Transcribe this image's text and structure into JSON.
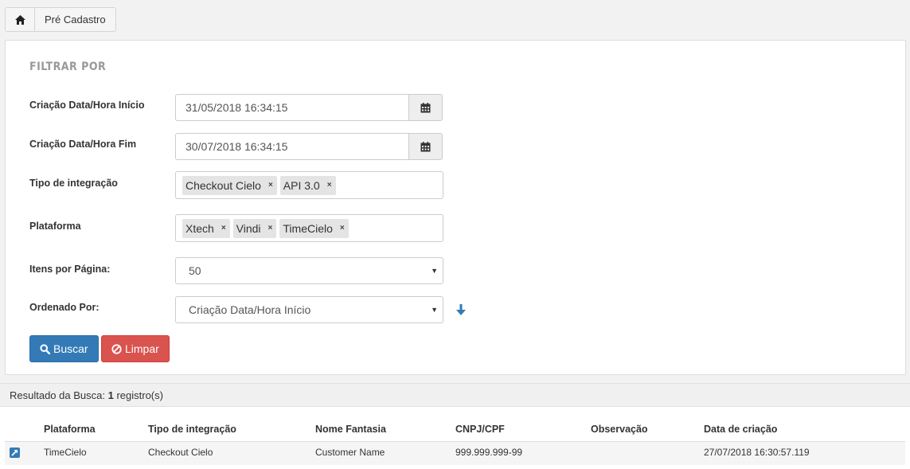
{
  "breadcrumb": {
    "home_icon": "home-icon",
    "current": "Pré Cadastro"
  },
  "filter": {
    "title": "FILTRAR POR",
    "creation_start": {
      "label": "Criação Data/Hora Início",
      "value": "31/05/2018 16:34:15"
    },
    "creation_end": {
      "label": "Criação Data/Hora Fim",
      "value": "30/07/2018 16:34:15"
    },
    "integration_type": {
      "label": "Tipo de integração",
      "tags": [
        "Checkout Cielo",
        "API 3.0"
      ]
    },
    "platform": {
      "label": "Plataforma",
      "tags": [
        "Xtech",
        "Vindi",
        "TimeCielo"
      ]
    },
    "items_per_page": {
      "label": "Itens por Página:",
      "value": "50"
    },
    "order_by": {
      "label": "Ordenado Por:",
      "value": "Criação Data/Hora Início"
    },
    "tag_remove": "×",
    "search_button": "Buscar",
    "clear_button": "Limpar"
  },
  "result": {
    "prefix": "Resultado da Busca:",
    "count": "1",
    "suffix": "registro(s)"
  },
  "table": {
    "headers": [
      "Plataforma",
      "Tipo de integração",
      "Nome Fantasia",
      "CNPJ/CPF",
      "Observação",
      "Data de criação"
    ],
    "rows": [
      [
        "TimeCielo",
        "Checkout Cielo",
        "Customer Name",
        "999.999.999-99",
        "",
        "27/07/2018 16:30:57.119"
      ]
    ]
  },
  "colors": {
    "primary": "#337ab7",
    "danger": "#d9534f"
  }
}
